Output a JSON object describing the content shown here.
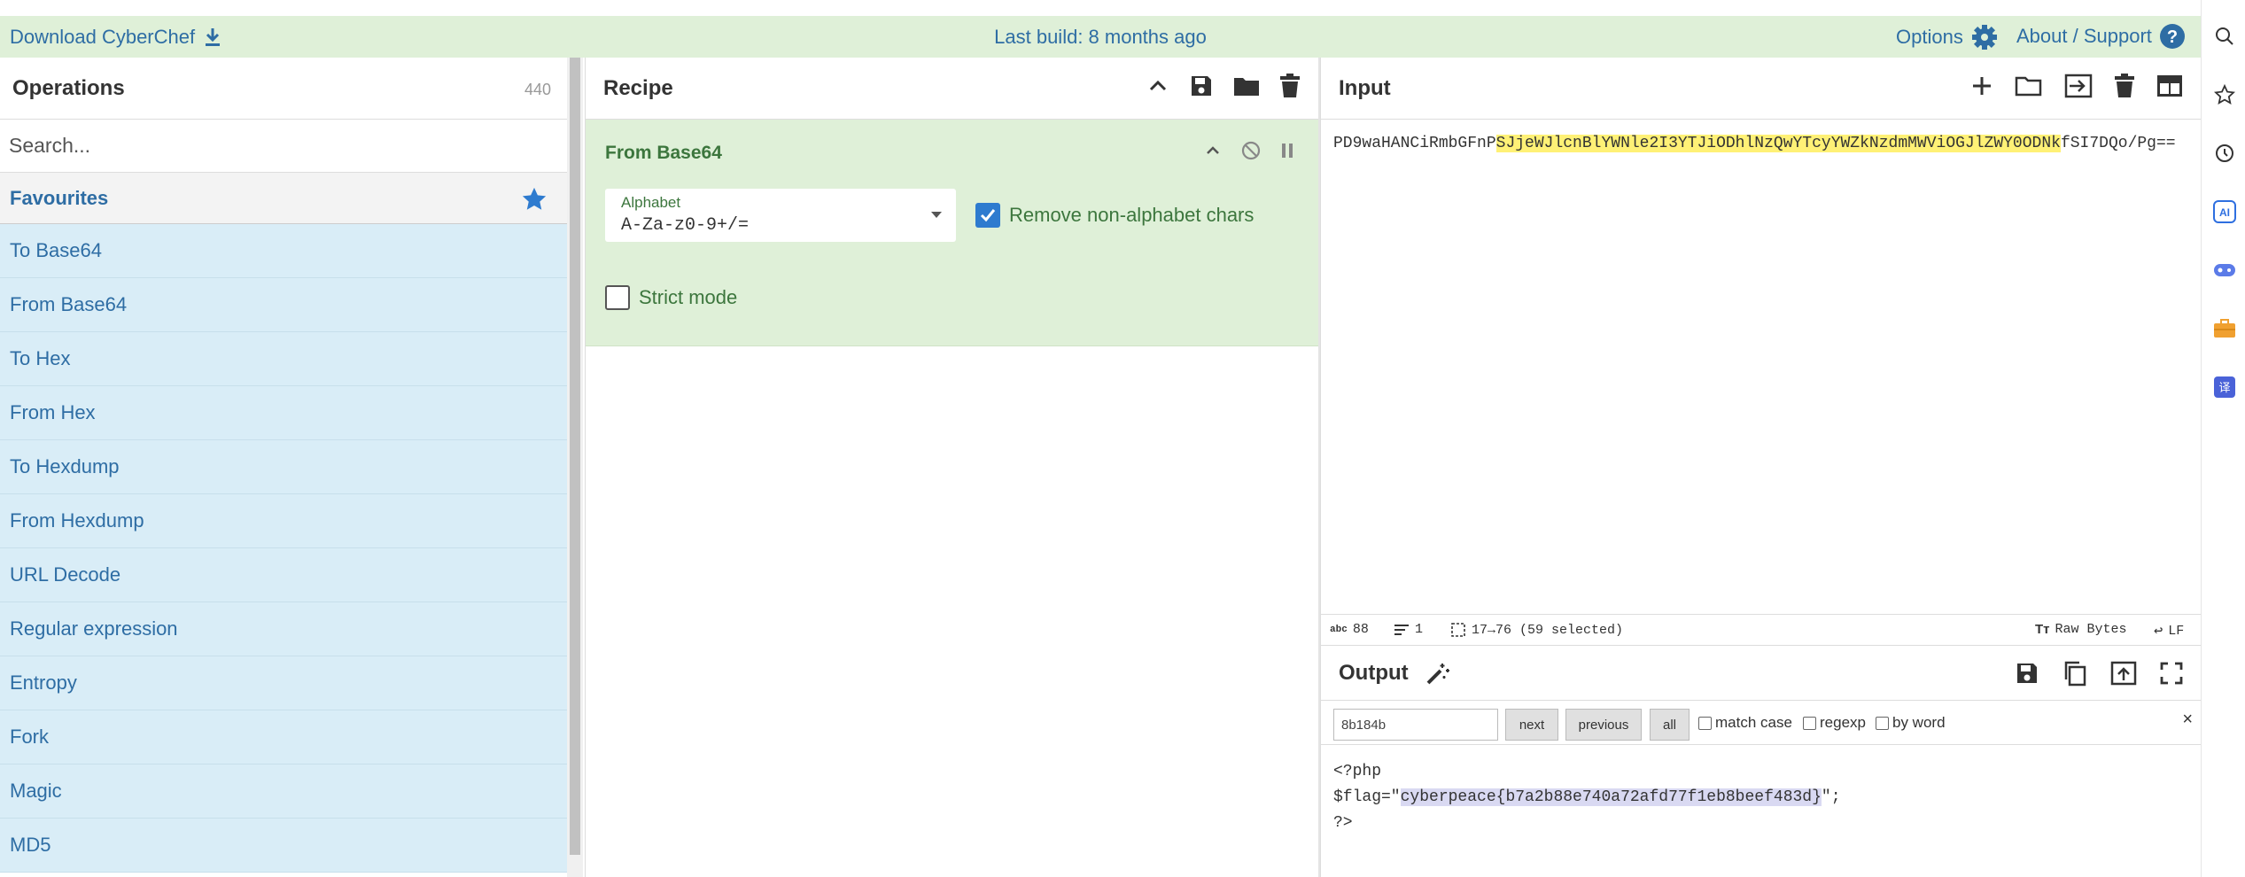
{
  "banner": {
    "download_label": "Download CyberChef",
    "last_build": "Last build: 8 months ago",
    "options_label": "Options",
    "about_label": "About / Support"
  },
  "operations": {
    "title": "Operations",
    "count": "440",
    "search_placeholder": "Search...",
    "favourites_label": "Favourites",
    "items": [
      {
        "label": "To Base64"
      },
      {
        "label": "From Base64"
      },
      {
        "label": "To Hex"
      },
      {
        "label": "From Hex"
      },
      {
        "label": "To Hexdump"
      },
      {
        "label": "From Hexdump"
      },
      {
        "label": "URL Decode"
      },
      {
        "label": "Regular expression"
      },
      {
        "label": "Entropy"
      },
      {
        "label": "Fork"
      },
      {
        "label": "Magic"
      },
      {
        "label": "MD5"
      }
    ]
  },
  "recipe": {
    "title": "Recipe",
    "operation": {
      "name": "From Base64",
      "alphabet_label": "Alphabet",
      "alphabet_value": "A-Za-z0-9+/=",
      "remove_nonalpha_label": "Remove non-alphabet chars",
      "remove_nonalpha_checked": true,
      "strict_mode_label": "Strict mode",
      "strict_mode_checked": false
    }
  },
  "input": {
    "title": "Input",
    "text_before": "PD9waHANCiRmbGFnP",
    "text_selected": "SJjeWJlcnBlYWNle2I3YTJiODhlNzQwYTcyYWZkNzdmMWViOGJlZWY0ODNk",
    "text_after": "fSI7DQo/Pg==",
    "status": {
      "length_label": "88",
      "lines_label": "1",
      "selection_label": "17→76 (59 selected)",
      "encoding_label": "Raw Bytes",
      "eol_label": "LF"
    }
  },
  "output": {
    "title": "Output",
    "find_value": "8b184b",
    "btn_next": "next",
    "btn_previous": "previous",
    "btn_all": "all",
    "opt_match_case": "match case",
    "opt_regexp": "regexp",
    "opt_by_word": "by word",
    "close_glyph": "×",
    "line1": "<?php",
    "line2_before": "$flag=\"",
    "line2_selected": "cyberpeace{b7a2b88e740a72afd77f1eb8beef483d}",
    "line2_after": "\";",
    "line3": "?>"
  },
  "colors": {
    "banner_bg": "#dff0d8",
    "link_blue": "#2e6da4",
    "recipe_green_bg": "#dff0d8",
    "ops_list_bg": "#d9edf7",
    "highlight_yellow": "#fff176",
    "selection_purple": "#d9d9f2",
    "checkbox_blue": "#2e7bcf"
  }
}
